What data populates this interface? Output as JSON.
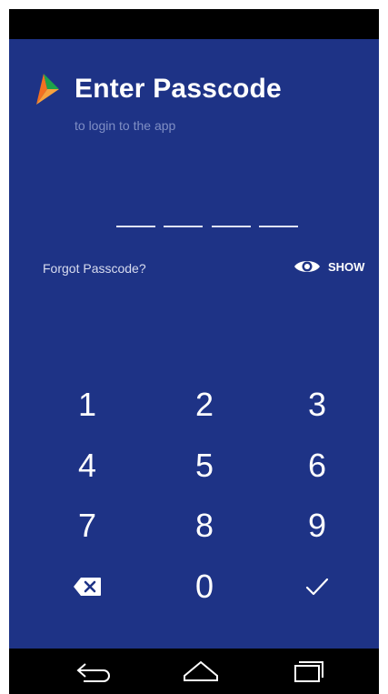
{
  "header": {
    "title": "Enter Passcode",
    "subtitle": "to login to the app",
    "logo_icon": "bhim-logo-icon"
  },
  "passcode": {
    "length": 4,
    "entered": 0
  },
  "links": {
    "forgot": "Forgot Passcode?",
    "show_label": "SHOW",
    "show_icon": "eye-icon"
  },
  "keypad": {
    "digits": [
      "1",
      "2",
      "3",
      "4",
      "5",
      "6",
      "7",
      "8",
      "9",
      "0"
    ],
    "backspace_icon": "backspace-icon",
    "submit_icon": "check-icon"
  },
  "navbar": {
    "back_icon": "back-icon",
    "home_icon": "home-icon",
    "recents_icon": "recents-icon"
  },
  "colors": {
    "background": "#1e3386",
    "subtitle": "#7f8ec4"
  }
}
